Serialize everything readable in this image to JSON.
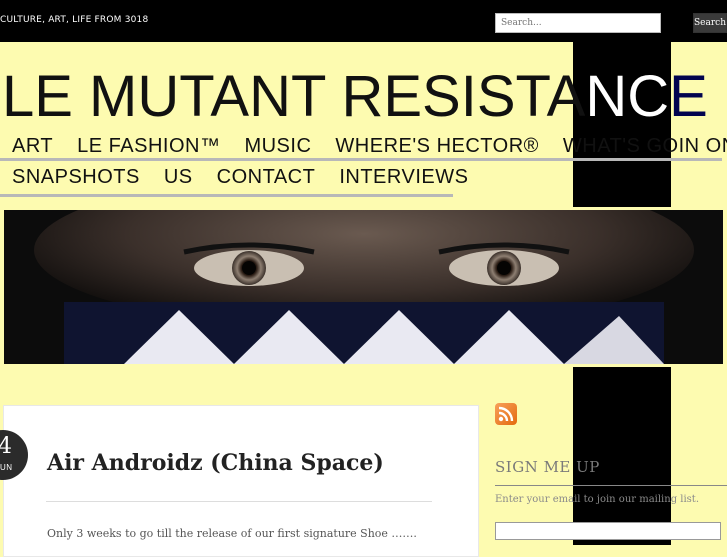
{
  "header": {
    "tagline": "CULTURE, ART, LIFE FROM 3018",
    "search_placeholder": "Search...",
    "search_button": "Search"
  },
  "site": {
    "title_a": "LE MUTANT RESISTA",
    "title_b": "NCE"
  },
  "nav": {
    "row1": [
      "ART",
      "LE FASHION™",
      "MUSIC",
      "WHERE'S HECTOR®",
      "WHAT'S GOIN ON?"
    ],
    "row2": [
      "SNAPSHOTS",
      "US",
      "CONTACT",
      "INTERVIEWS"
    ]
  },
  "post": {
    "day": "4",
    "month": "UN",
    "title": "Air Androidz (China Space)",
    "excerpt": "Only 3 weeks to go till the release of our first signature Shoe ……."
  },
  "sidebar": {
    "rss_icon": "rss-icon",
    "widget_title": "SIGN ME UP",
    "widget_text": "Enter your email to join our mailing list."
  },
  "colors": {
    "background": "#fdfbb0",
    "topbar": "#000000",
    "rss": "#f08a24"
  }
}
